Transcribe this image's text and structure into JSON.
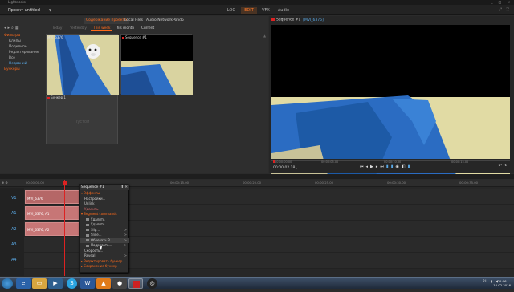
{
  "window": {
    "title": "Lightworks",
    "controls": "_ □ ×"
  },
  "menubar": {
    "project": "Проект untitled",
    "tabs": [
      {
        "label": "LOG",
        "active": false
      },
      {
        "label": "EDIT",
        "active": true
      },
      {
        "label": "VFX",
        "active": false
      },
      {
        "label": "Audio",
        "active": false
      }
    ]
  },
  "library": {
    "source_tabs": [
      {
        "label": "Содержание проекта",
        "active": true
      },
      {
        "label": "Local Files",
        "active": false
      },
      {
        "label": "Audio Network",
        "active": false
      },
      {
        "label": "Pond5",
        "active": false
      }
    ],
    "filter_tabs": [
      {
        "label": "Today",
        "active": false,
        "bright": false
      },
      {
        "label": "Yesterday",
        "active": false,
        "bright": false
      },
      {
        "label": "This week",
        "active": true,
        "bright": false
      },
      {
        "label": "This month",
        "active": false,
        "bright": true
      },
      {
        "label": "Current",
        "active": false,
        "bright": true
      }
    ],
    "tree": [
      {
        "label": "Фильтры",
        "type": "cat"
      },
      {
        "label": "Клипы",
        "type": "item"
      },
      {
        "label": "Подклипы",
        "type": "item"
      },
      {
        "label": "Редактирование",
        "type": "item"
      },
      {
        "label": "Все",
        "type": "item"
      },
      {
        "label": "Недавний",
        "type": "hl"
      },
      {
        "label": "Бункеры",
        "type": "cat"
      }
    ],
    "thumbs": {
      "clip1": "MVI_6376",
      "seq1": "Sequence #1",
      "empty_title": "Бункер 1",
      "empty_center": "Пустой"
    }
  },
  "preview": {
    "title": "Sequence #1",
    "subtitle": "[MVI_6376]",
    "ruler_ticks": [
      "00:00:00.00",
      "00:00:05.00",
      "00:00:10.00",
      "00:00:15.00"
    ],
    "timecode": "00:00:02.18"
  },
  "timeline": {
    "ruler_ticks": [
      "00:00:00.00",
      "00:00:15.00",
      "00:00:20.00",
      "00:00:25.00",
      "00:00:30.00",
      "00:00:35.00",
      "00:00:40.00"
    ],
    "sequence_label": "Sequence #1",
    "tracks": [
      "V1",
      "A1",
      "A2",
      "A3",
      "A4"
    ],
    "clips": {
      "v1": "MVI_6376",
      "a1": "MVI_6376, A1",
      "a2": "MVI_6376, A2"
    }
  },
  "context_menu": {
    "title": "Sequence #1",
    "items": [
      {
        "label": "Эффекты",
        "type": "sec"
      },
      {
        "label": "Настройки...",
        "type": "item"
      },
      {
        "label": "Unlink",
        "type": "item"
      },
      {
        "label": "Удалить",
        "type": "item",
        "color": "#d86a6a"
      },
      {
        "label": "Segment commands",
        "type": "sec"
      },
      {
        "label": "Удалить",
        "type": "sub"
      },
      {
        "label": "Удалить",
        "type": "sub"
      },
      {
        "label": "Slip...",
        "type": "sub",
        "arrow": ">"
      },
      {
        "label": "Slide...",
        "type": "sub",
        "arrow": ">"
      },
      {
        "label": "Обрезать В...",
        "type": "sub",
        "arrow": ">",
        "hover": true
      },
      {
        "label": "Подрезать...",
        "type": "sub",
        "arrow": ">"
      },
      {
        "label": "Скорость...",
        "type": "item"
      },
      {
        "label": "Reveal",
        "type": "item",
        "arrow": ">"
      },
      {
        "label": "Редактировать бункер",
        "type": "sec"
      },
      {
        "label": "Сохранение бункер",
        "type": "sec"
      }
    ]
  },
  "taskbar": {
    "apps": [
      "ie-icon",
      "folder-icon",
      "media-icon",
      "skype-icon",
      "word-icon",
      "vlc-icon",
      "recorder-icon",
      "lightworks-icon",
      "camera-icon"
    ],
    "lang": "RU",
    "time": "22:06",
    "date": "16.02.2016"
  },
  "colors": {
    "accent": "#ff6a1a",
    "clip": "#b56767",
    "playhead": "#dd2222",
    "highlight_blue": "#5aa9e6"
  }
}
